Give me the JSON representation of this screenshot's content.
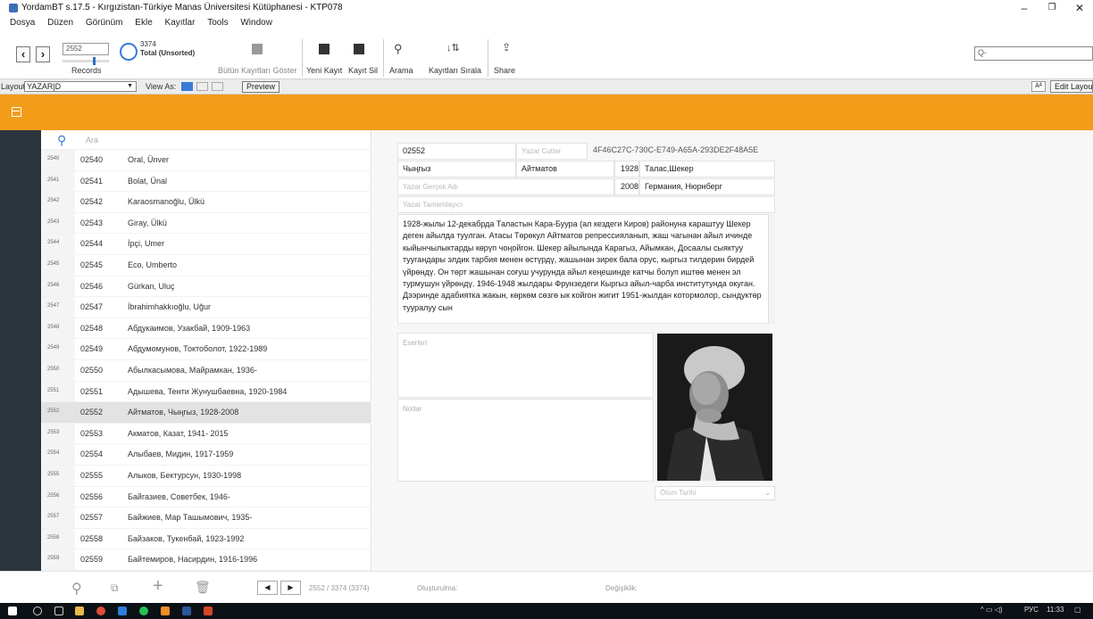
{
  "window": {
    "title": "YordamBT s.17.5 - Kırgızistan-Türkiye Manas Üniversitesi Kütüphanesi - KTP078",
    "minimize": "–",
    "restore": "❐",
    "close": "✕"
  },
  "menu": [
    "Dosya",
    "Düzen",
    "Görünüm",
    "Ekle",
    "Kayıtlar",
    "Tools",
    "Window"
  ],
  "toolbar": {
    "record_input": "2552",
    "records_label": "Records",
    "total_count": "3374",
    "total_label": "Total (Unsorted)",
    "show_all": "Bütün Kayıtları Göster",
    "new_record": "Yeni Kayıt",
    "delete_record": "Kayıt Sil",
    "search": "Arama",
    "sort": "Kayıtları Sırala",
    "share": "Share",
    "search_placeholder": "Q-"
  },
  "layoutbar": {
    "layout_label": "Layout:",
    "layout_value": "YAZAR|D",
    "view_as": "View As:",
    "preview": "Preview",
    "aa": "Aᴬ",
    "edit_layout": "Edit Layout"
  },
  "list": {
    "search_placeholder": "Ara",
    "rows": [
      {
        "n": "2540",
        "id": "02540",
        "name": "Oral, Ünver"
      },
      {
        "n": "2541",
        "id": "02541",
        "name": "Bolat, Ünal"
      },
      {
        "n": "2542",
        "id": "02542",
        "name": "Karaosmanoğlu, Ülkü"
      },
      {
        "n": "2543",
        "id": "02543",
        "name": "Giray, Ülkü"
      },
      {
        "n": "2544",
        "id": "02544",
        "name": "İpçi, Umer"
      },
      {
        "n": "2545",
        "id": "02545",
        "name": "Eco, Umberto"
      },
      {
        "n": "2546",
        "id": "02546",
        "name": "Gürkan, Uluç"
      },
      {
        "n": "2547",
        "id": "02547",
        "name": "İbrahimhakkıoğlu, Uğur"
      },
      {
        "n": "2548",
        "id": "02548",
        "name": "Абдукаимов, Узакбай, 1909-1963"
      },
      {
        "n": "2549",
        "id": "02549",
        "name": "Абдумомунов, Токтоболот, 1922-1989"
      },
      {
        "n": "2550",
        "id": "02550",
        "name": "Абылкасымова, Майрамкан, 1936-"
      },
      {
        "n": "2551",
        "id": "02551",
        "name": "Адышева, Тенти Жунушбаевна, 1920-1984"
      },
      {
        "n": "2552",
        "id": "02552",
        "name": "Айтматов, Чыңгыз, 1928-2008"
      },
      {
        "n": "2553",
        "id": "02553",
        "name": "Акматов, Казат, 1941- 2015"
      },
      {
        "n": "2554",
        "id": "02554",
        "name": "Алыбаев, Мидин, 1917-1959"
      },
      {
        "n": "2555",
        "id": "02555",
        "name": "Алыков, Бектурсун, 1930-1998"
      },
      {
        "n": "2556",
        "id": "02556",
        "name": "Байгазиев, Советбек, 1946-"
      },
      {
        "n": "2557",
        "id": "02557",
        "name": "Байжиев, Мар Ташымович, 1935-"
      },
      {
        "n": "2558",
        "id": "02558",
        "name": "Байзаков, Тукенбай, 1923-1992"
      },
      {
        "n": "2559",
        "id": "02559",
        "name": "Байтемиров, Насирдин, 1916-1996"
      }
    ]
  },
  "detail": {
    "id": "02552",
    "cutter_label": "Yazar Cutter",
    "guid": "4F46C27C-730C-E749-A65A-293DE2F48A5E",
    "first_name": "Чыңгыз",
    "last_name": "Айтматов",
    "birth_year": "1928",
    "birth_place": "Талас,Шекер",
    "real_name_label": "Yazar Gerçek Adı",
    "death_year": "2008",
    "death_place": "Германия, Нюрнберг",
    "full_label": "Yazar Tamamlayıcı",
    "bio": "1928-жылы 12-декабрда Таластын Кара-Буура (ал кездеги Киров) районуна караштуу Шекер деген айылда туулган. Атасы Төрөкул Айтматов репрессияланып, жаш чагынан айыл ичинде кыйынчылыктарды көрүп чоңойгон. Шекер айылында Карагыз, Айымкан, Досаалы сыяктуу туугандары элдик тарбия менен өстүрдү, жашынан зирек бала орус, кыргыз тилдерин бирдей үйрөндү. Он төрт жашынан соғуш учурунда айыл кеңешинде катчы болуп иштөө менен эл турмушун үйрөндү. 1946-1948 жылдары Фрунзедеги Кыргыз айыл-чарба институтунда окуган. Дээринде адабиятка жакын, көркөм сөзгө ык койгон жигит 1951-жылдан котормолор, сындуктөр тууралуу сын",
    "works_label": "Eserleri",
    "notes_label": "Notlar",
    "death_date_label": "Ölüm Tarihi"
  },
  "bottom": {
    "pager": "2552 / 3374 (3374)",
    "created_label": "Oluşturulma:",
    "modified_label": "Değişiklik:"
  },
  "taskbar": {
    "lang": "РУС",
    "time": "11:33"
  }
}
